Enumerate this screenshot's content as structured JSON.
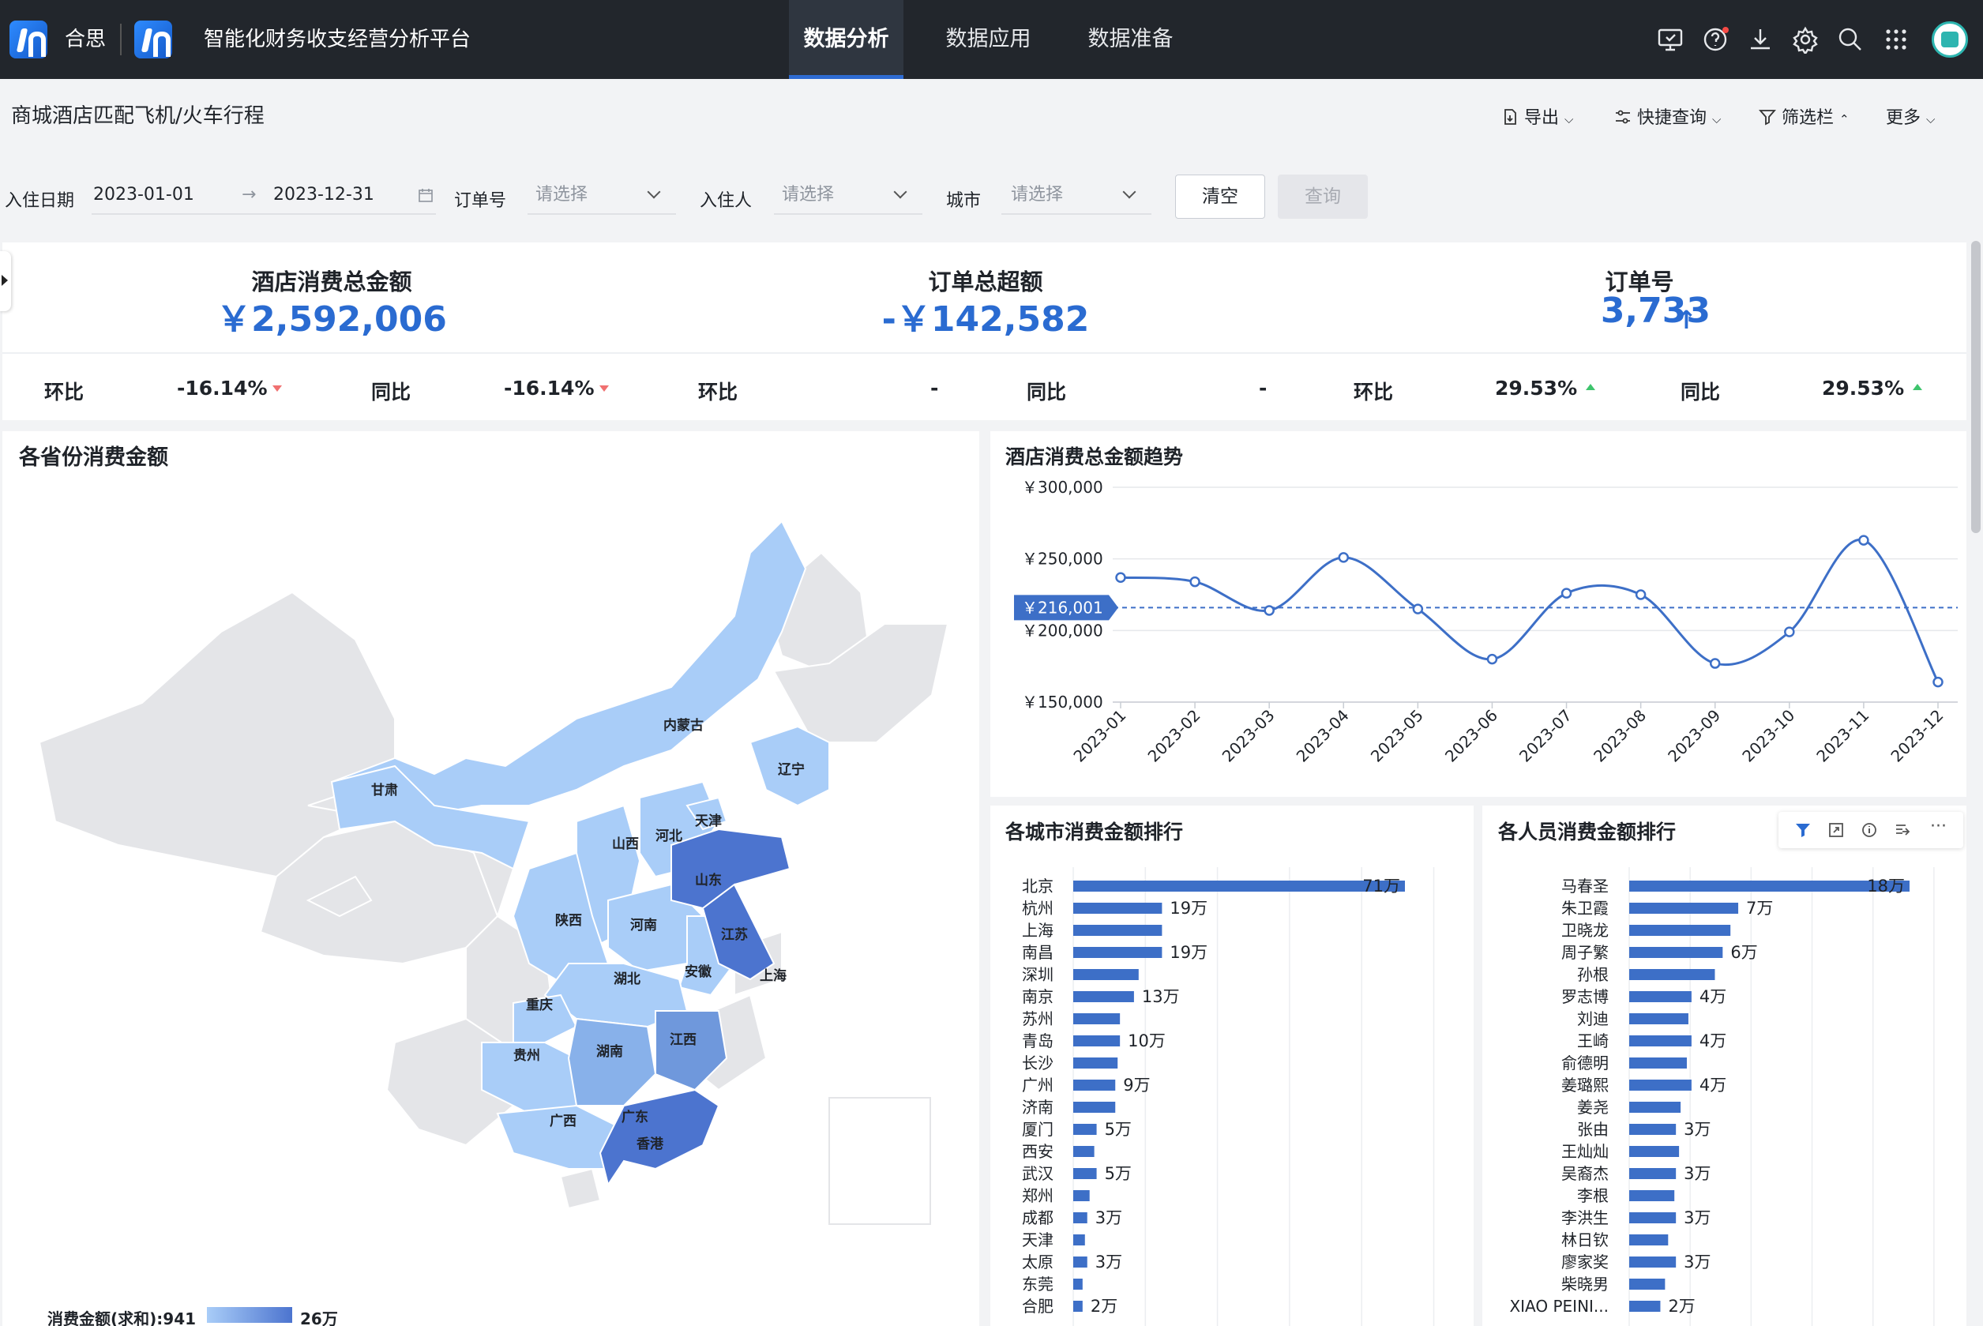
{
  "brand": {
    "name": "合思",
    "platform": "智能化财务收支经营分析平台"
  },
  "nav": {
    "tabs": [
      {
        "label": "数据分析",
        "active": true
      },
      {
        "label": "数据应用"
      },
      {
        "label": "数据准备"
      }
    ]
  },
  "top_icons": [
    "screen-icon",
    "help-icon",
    "download-icon",
    "gear-icon",
    "search-icon",
    "apps-grid-icon"
  ],
  "page": {
    "title": "商城酒店匹配飞机/火车行程"
  },
  "toolbar": {
    "export": "导出",
    "quick_query": "快捷查询",
    "filter_bar": "筛选栏",
    "more": "更多"
  },
  "filters": {
    "checkin_label": "入住日期",
    "date_start": "2023-01-01",
    "date_end": "2023-12-31",
    "order_label": "订单号",
    "order_ph": "请选择",
    "guest_label": "入住人",
    "guest_ph": "请选择",
    "city_label": "城市",
    "city_ph": "请选择",
    "clear": "清空",
    "query": "查询"
  },
  "kpis": [
    {
      "title": "酒店消费总金额",
      "value": "￥2,592,006",
      "hb_label": "环比",
      "hb": "-16.14%",
      "tb_label": "同比",
      "tb": "-16.14%"
    },
    {
      "title": "订单总超额",
      "value": "-￥142,582",
      "hb_label": "环比",
      "hb": "-",
      "tb_label": "同比",
      "tb": "-"
    },
    {
      "title": "订单号",
      "value": "3,733",
      "arrow": "↑",
      "hb_label": "环比",
      "hb": "29.53%",
      "tb_label": "同比",
      "tb": "29.53%"
    }
  ],
  "map": {
    "title": "各省份消费金额",
    "labels": [
      "内蒙古",
      "辽宁",
      "甘肃",
      "天津",
      "河北",
      "山西",
      "山东",
      "陕西",
      "河南",
      "江苏",
      "安徽",
      "上海",
      "湖北",
      "重庆",
      "贵州",
      "湖南",
      "江西",
      "广西",
      "广东",
      "香港"
    ],
    "legend_label": "消费金额(求和):941",
    "legend_max": "26万"
  },
  "trend": {
    "title": "酒店消费总金额趋势"
  },
  "city_rank": {
    "title": "各城市消费金额排行"
  },
  "person_rank": {
    "title": "各人员消费金额排行"
  },
  "chart_data": [
    {
      "type": "line",
      "title": "酒店消费总金额趋势",
      "x": [
        "2023-01",
        "2023-02",
        "2023-03",
        "2023-04",
        "2023-05",
        "2023-06",
        "2023-07",
        "2023-08",
        "2023-09",
        "2023-10",
        "2023-11",
        "2023-12"
      ],
      "values": [
        237000,
        234000,
        214000,
        251000,
        215000,
        180000,
        226000,
        225000,
        177000,
        199000,
        263000,
        164000
      ],
      "y_ticks": [
        "￥300,000",
        "￥250,000",
        "￥200,000",
        "￥150,000"
      ],
      "ylim": [
        150000,
        300000
      ],
      "reference_line": {
        "value": 216001,
        "label": "￥216,001"
      }
    },
    {
      "type": "bar",
      "orientation": "horizontal",
      "title": "各城市消费金额排行",
      "categories": [
        "北京",
        "杭州",
        "上海",
        "南昌",
        "深圳",
        "南京",
        "苏州",
        "青岛",
        "长沙",
        "广州",
        "济南",
        "厦门",
        "西安",
        "武汉",
        "郑州",
        "成都",
        "天津",
        "太原",
        "东莞",
        "合肥"
      ],
      "values": [
        710000,
        190000,
        190000,
        190000,
        140000,
        130000,
        100000,
        100000,
        95000,
        90000,
        90000,
        50000,
        45000,
        50000,
        35000,
        30000,
        25000,
        30000,
        20000,
        20000
      ],
      "data_labels": [
        "71万",
        "19万",
        "",
        "19万",
        "",
        "13万",
        "",
        "10万",
        "",
        "9万",
        "",
        "5万",
        "",
        "5万",
        "",
        "3万",
        "",
        "3万",
        "",
        "2万"
      ]
    },
    {
      "type": "bar",
      "orientation": "horizontal",
      "title": "各人员消费金额排行",
      "categories": [
        "马春圣",
        "朱卫霞",
        "卫晓龙",
        "周子繁",
        "孙根",
        "罗志博",
        "刘迪",
        "王崎",
        "俞德明",
        "姜璐熙",
        "姜尧",
        "张由",
        "王灿灿",
        "吴裔杰",
        "李根",
        "李洪生",
        "林日钦",
        "廖家奖",
        "柴晓男",
        "XIAO PEINI..."
      ],
      "values": [
        180000,
        70000,
        65000,
        60000,
        55000,
        40000,
        38000,
        40000,
        37000,
        40000,
        33000,
        30000,
        32000,
        30000,
        29000,
        30000,
        25000,
        30000,
        23000,
        20000
      ],
      "data_labels": [
        "18万",
        "7万",
        "",
        "6万",
        "",
        "4万",
        "",
        "4万",
        "",
        "4万",
        "",
        "3万",
        "",
        "3万",
        "",
        "3万",
        "",
        "3万",
        "",
        "2万"
      ]
    }
  ]
}
